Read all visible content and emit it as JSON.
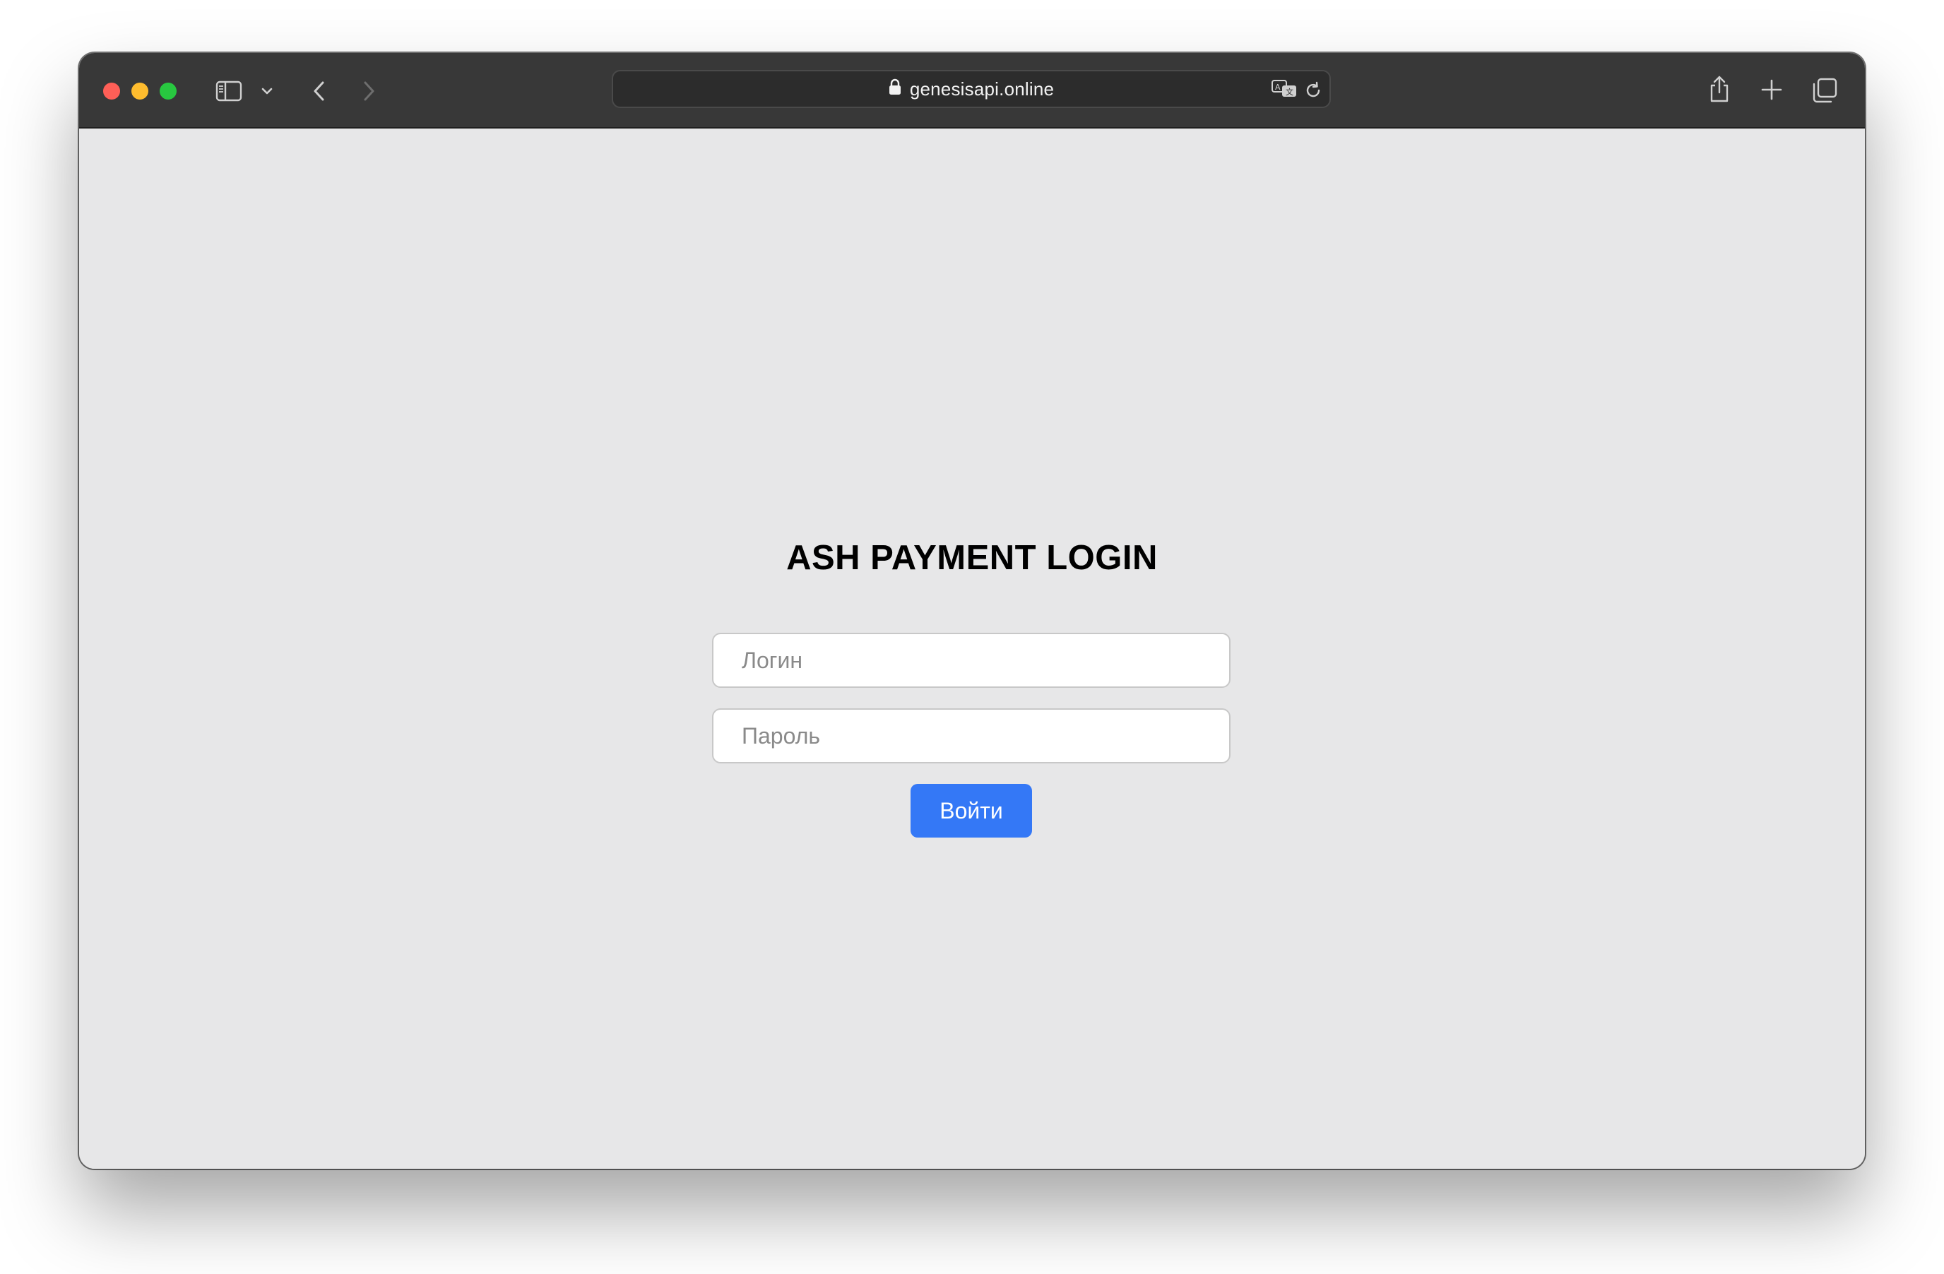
{
  "browser": {
    "url": "genesisapi.online",
    "colors": {
      "toolbar": "#383838",
      "close": "#ff5f57",
      "minimize": "#febc2e",
      "maximize": "#28c840"
    },
    "icons": {
      "sidebar": "sidebar-icon",
      "tabs_menu": "chevron-down-icon",
      "back": "chevron-left-icon",
      "forward": "chevron-right-icon",
      "lock": "lock-icon",
      "translate": "translate-icon",
      "reload": "reload-icon",
      "share": "share-icon",
      "new_tab": "plus-icon",
      "tab_overview": "tab-overview-icon"
    }
  },
  "page": {
    "title": "ASH PAYMENT LOGIN",
    "login_placeholder": "Логин",
    "password_placeholder": "Пароль",
    "submit_label": "Войти",
    "accent_color": "#3478f6",
    "background_color": "#e7e7e8"
  }
}
